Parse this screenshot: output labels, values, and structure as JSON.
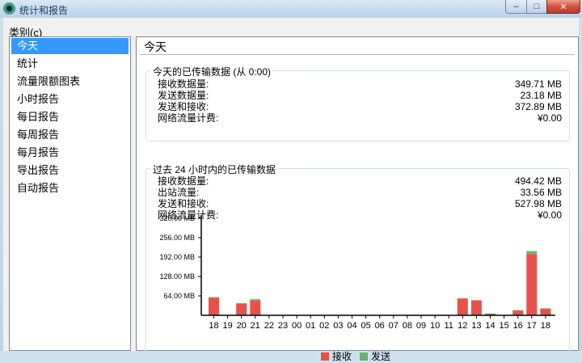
{
  "window": {
    "title": "统计和报告"
  },
  "sidebar": {
    "label": "类别(",
    "label_hotkey": "c",
    "label_end": ")",
    "items": [
      {
        "label": "今天",
        "selected": true
      },
      {
        "label": "统计"
      },
      {
        "label": "流量限额图表"
      },
      {
        "label": "小时报告"
      },
      {
        "label": "每日报告"
      },
      {
        "label": "每周报告"
      },
      {
        "label": "每月报告"
      },
      {
        "label": "导出报告"
      },
      {
        "label": "自动报告"
      }
    ]
  },
  "main": {
    "title": "今天",
    "today": {
      "title": "今天的已传输数据 (从 0:00)",
      "rows": [
        {
          "label": "接收数据量:",
          "value": "349.71 MB"
        },
        {
          "label": "发送数据量:",
          "value": "23.18 MB"
        },
        {
          "label": "发送和接收:",
          "value": "372.89 MB"
        },
        {
          "label": "网络流量计费:",
          "value": "¥0.00"
        }
      ]
    },
    "past24": {
      "title": "过去 24 小时内的已传输数据",
      "rows": [
        {
          "label": "接收数据量:",
          "value": "494.42 MB"
        },
        {
          "label": "出站流量:",
          "value": "33.56 MB"
        },
        {
          "label": "发送和接收:",
          "value": "527.98 MB"
        },
        {
          "label": "网络流量计费:",
          "value": "¥0.00"
        }
      ]
    }
  },
  "colors": {
    "receive": "#e8514a",
    "send": "#6ab36b",
    "selection": "#3399ff"
  },
  "chart_data": {
    "type": "bar",
    "stacked": true,
    "categories": [
      "18",
      "19",
      "20",
      "21",
      "22",
      "23",
      "00",
      "01",
      "02",
      "03",
      "04",
      "05",
      "06",
      "07",
      "08",
      "09",
      "10",
      "11",
      "12",
      "13",
      "14",
      "15",
      "16",
      "17",
      "18"
    ],
    "series": [
      {
        "name": "接收",
        "values": [
          58,
          0,
          38,
          48,
          0,
          0,
          0,
          0,
          0,
          0,
          0,
          0,
          0,
          0,
          0,
          0,
          0,
          0,
          54,
          48,
          5,
          0,
          16,
          202,
          22
        ]
      },
      {
        "name": "发送",
        "values": [
          2,
          0,
          2,
          5,
          0,
          0,
          0,
          0,
          0,
          0,
          0,
          0,
          0,
          0,
          0,
          0,
          0,
          0,
          3,
          2,
          1,
          0,
          1,
          10,
          1
        ]
      }
    ],
    "yticks": [
      "64.00 MB",
      "128.00 MB",
      "192.00 MB",
      "256.00 MB",
      "320.00 MB"
    ],
    "ylim": [
      0,
      320
    ],
    "legend": "bottom"
  }
}
